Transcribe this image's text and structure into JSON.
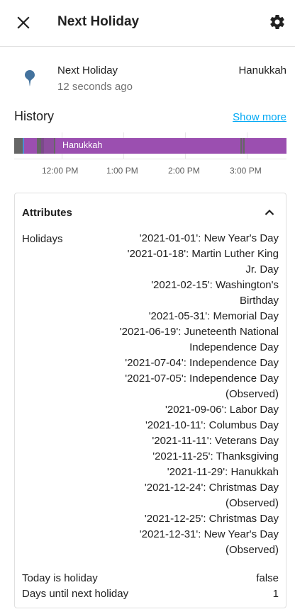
{
  "dialog": {
    "title": "Next Holiday"
  },
  "entity": {
    "name": "Next Holiday",
    "last_changed": "12 seconds ago",
    "state": "Hanukkah",
    "icon": "map-marker-icon"
  },
  "history": {
    "title": "History",
    "show_more": "Show more",
    "bar_label": "Hanukkah",
    "ticks": [
      "12:00 PM",
      "1:00 PM",
      "2:00 PM",
      "3:00 PM"
    ],
    "colors": {
      "main": "#9b4fb0",
      "gray": "#666666",
      "blue": "#4a8fd4",
      "purple_dark": "#7b4a8a"
    }
  },
  "attributes": {
    "title": "Attributes",
    "holidays_label": "Holidays",
    "holidays": [
      "'2021-01-01': New Year's Day",
      "'2021-01-18': Martin Luther King Jr. Day",
      "'2021-02-15': Washington's Birthday",
      "'2021-05-31': Memorial Day",
      "'2021-06-19': Juneteenth National Independence Day",
      "'2021-07-04': Independence Day",
      "'2021-07-05': Independence Day (Observed)",
      "'2021-09-06': Labor Day",
      "'2021-10-11': Columbus Day",
      "'2021-11-11': Veterans Day",
      "'2021-11-25': Thanksgiving",
      "'2021-11-29': Hanukkah",
      "'2021-12-24': Christmas Day (Observed)",
      "'2021-12-25': Christmas Day",
      "'2021-12-31': New Year's Day (Observed)"
    ],
    "today_is_holiday_label": "Today is holiday",
    "today_is_holiday_value": "false",
    "days_until_label": "Days until next holiday",
    "days_until_value": "1"
  }
}
